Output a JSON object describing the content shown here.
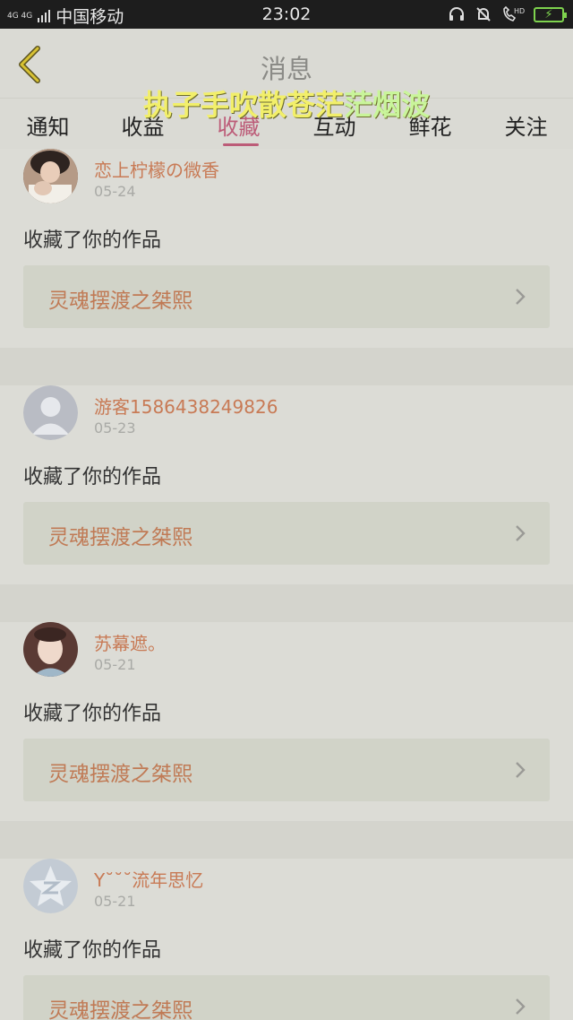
{
  "status_bar": {
    "network": "4G 4G",
    "carrier": "中国移动",
    "time": "23:02",
    "icons": [
      "headset-icon",
      "mute-bell-icon",
      "hd-call-icon",
      "battery-charging-icon"
    ],
    "hd_label": "HD"
  },
  "header": {
    "title": "消息",
    "back_icon": "chevron-left-icon"
  },
  "caption": {
    "part1": "执子手吹散苍茫",
    "part2": "茫烟波"
  },
  "tabs": [
    {
      "label": "通知"
    },
    {
      "label": "收益"
    },
    {
      "label": "收藏",
      "active": true
    },
    {
      "label": "互动"
    },
    {
      "label": "鲜花"
    },
    {
      "label": "关注"
    }
  ],
  "colors": {
    "accent": "#bc5c78",
    "name": "#c87a55",
    "background": "#dcdcd6"
  },
  "items": [
    {
      "name": "恋上柠檬の微香",
      "date": "05-24",
      "action": "收藏了你的作品",
      "work_title": "灵魂摆渡之桀熙",
      "avatar": "photo-avatar"
    },
    {
      "name": "游客1586438249826",
      "date": "05-23",
      "action": "收藏了你的作品",
      "work_title": "灵魂摆渡之桀熙",
      "avatar": "default-user-avatar"
    },
    {
      "name": "苏幕遮。",
      "date": "05-21",
      "action": "收藏了你的作品",
      "work_title": "灵魂摆渡之桀熙",
      "avatar": "photo-avatar"
    },
    {
      "name": "Y˘˘˘流年思忆",
      "date": "05-21",
      "action": "收藏了你的作品",
      "work_title": "灵魂摆渡之桀熙",
      "avatar": "qzone-avatar"
    }
  ]
}
